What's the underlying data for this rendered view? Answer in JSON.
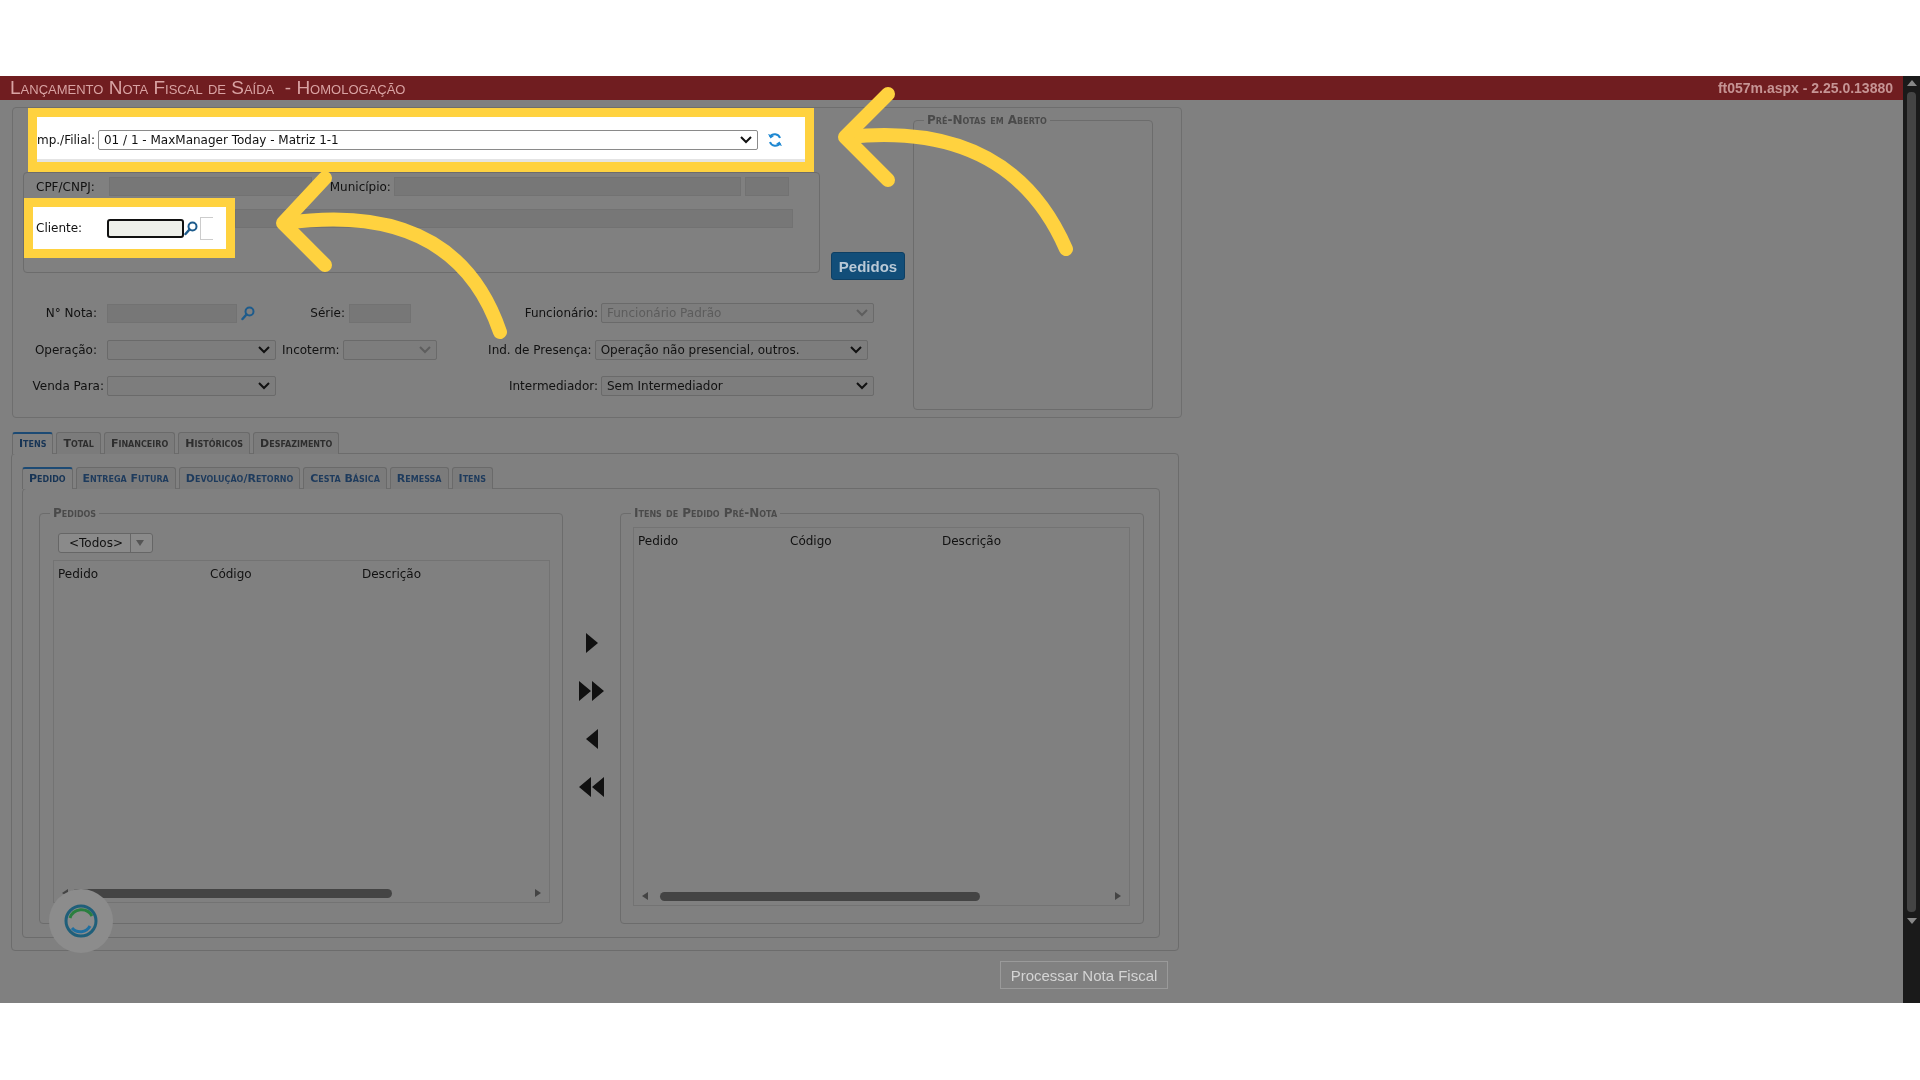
{
  "header": {
    "title": "Lançamento Nota Fiscal de Saída  - Homologação",
    "version": "ft057m.aspx - 2.25.0.13880"
  },
  "company": {
    "label": "mp./Filial:",
    "value": "01 / 1 - MaxManager Today - Matriz 1-1"
  },
  "customer": {
    "cpf_label": "CPF/CNPJ:",
    "municipio_label": "Município:",
    "cliente_label": "Cliente:"
  },
  "pedidos_button": "Pedidos",
  "pre_notas": {
    "title": "Pré-Notas em Aberto"
  },
  "nota": {
    "label": "N° Nota:"
  },
  "serie": {
    "label": "Série:"
  },
  "funcionario": {
    "label": "Funcionário:",
    "value": "Funcionário Padrão",
    "disabled": true
  },
  "operacao": {
    "label": "Operação:",
    "disabled": false
  },
  "incoterm": {
    "label": "Incoterm:",
    "disabled": true
  },
  "presenca": {
    "label": "Ind. de Presença:",
    "value": "Operação não presencial, outros.",
    "disabled": false
  },
  "venda_para": {
    "label": "Venda Para:",
    "disabled": false
  },
  "intermediador": {
    "label": "Intermediador:",
    "value": "Sem Intermediador",
    "disabled": false
  },
  "tabs": [
    {
      "label": "Itens",
      "selected": true
    },
    {
      "label": "Total",
      "selected": false
    },
    {
      "label": "Financeiro",
      "selected": false
    },
    {
      "label": "Históricos",
      "selected": false
    },
    {
      "label": "Desfazimento",
      "selected": false
    }
  ],
  "subtabs": [
    {
      "label": "Pedido",
      "selected": true
    },
    {
      "label": "Entrega Futura",
      "selected": false
    },
    {
      "label": "Devolução/Retorno",
      "selected": false
    },
    {
      "label": "Cesta Básica",
      "selected": false
    },
    {
      "label": "Remessa",
      "selected": false
    },
    {
      "label": "Itens",
      "selected": false
    }
  ],
  "pedidos": {
    "title": "Pedidos",
    "filter": "<Todos>",
    "columns": [
      "Pedido",
      "Código",
      "Descrição"
    ]
  },
  "itens_pre_nota": {
    "title": "Itens de Pedido Pré-Nota",
    "columns": [
      "Pedido",
      "Código",
      "Descrição"
    ]
  },
  "process_button": {
    "label": "Processar Nota Fiscal",
    "disabled": true
  }
}
